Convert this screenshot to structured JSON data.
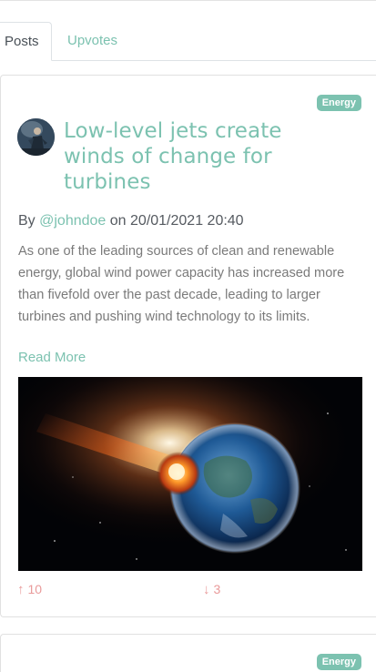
{
  "tabs": [
    {
      "label": "Posts",
      "active": true
    },
    {
      "label": "Upvotes",
      "active": false
    }
  ],
  "posts": [
    {
      "category": "Energy",
      "title": "Low-level jets create winds of change for turbines",
      "byline_prefix": "By",
      "author": "@johndoe",
      "byline_on": "on",
      "date": "20/01/2021 20:40",
      "excerpt": "As one of the leading sources of clean and renewable energy, global wind power capacity has increased more than fivefold over the past decade, leading to larger turbines and pushing wind technology to its limits.",
      "read_more": "Read More",
      "upvotes": "10",
      "downvotes": "3",
      "up_icon": "arrow-up-icon",
      "down_icon": "arrow-down-icon"
    },
    {
      "category": "Energy"
    }
  ],
  "colors": {
    "accent": "#7cc2b0",
    "vote": "#e99a9a",
    "text": "#555a60",
    "muted": "#7a7a7a"
  }
}
